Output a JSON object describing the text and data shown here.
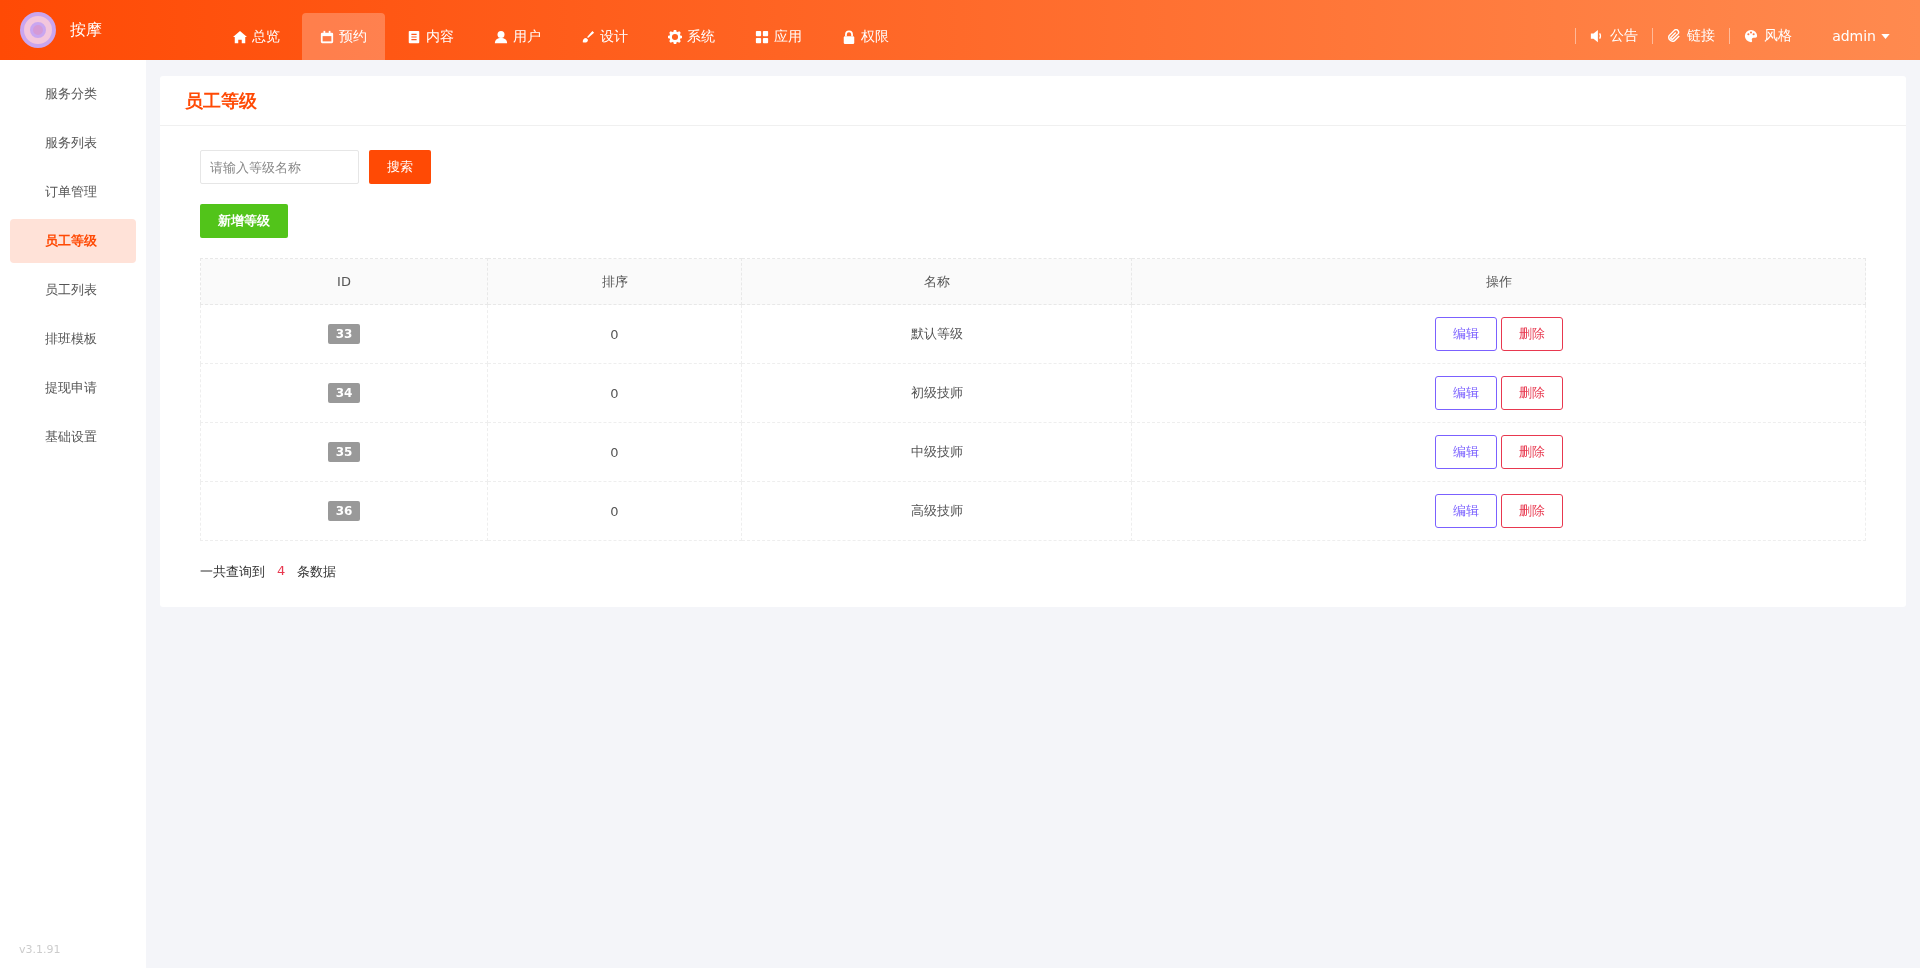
{
  "brand": {
    "name": "按摩"
  },
  "nav": [
    {
      "label": "总览",
      "kind": "home",
      "selected": false
    },
    {
      "label": "预约",
      "kind": "calendar",
      "selected": true
    },
    {
      "label": "内容",
      "kind": "document",
      "selected": false
    },
    {
      "label": "用户",
      "kind": "user",
      "selected": false
    },
    {
      "label": "设计",
      "kind": "brush",
      "selected": false
    },
    {
      "label": "系统",
      "kind": "gear",
      "selected": false
    },
    {
      "label": "应用",
      "kind": "grid",
      "selected": false
    },
    {
      "label": "权限",
      "kind": "lock",
      "selected": false
    }
  ],
  "header_links": [
    {
      "label": "公告",
      "kind": "speaker"
    },
    {
      "label": "链接",
      "kind": "paperclip"
    },
    {
      "label": "风格",
      "kind": "palette"
    }
  ],
  "user_menu": {
    "label": "admin"
  },
  "sidebar": {
    "items": [
      {
        "label": "服务分类",
        "selected": false
      },
      {
        "label": "服务列表",
        "selected": false
      },
      {
        "label": "订单管理",
        "selected": false
      },
      {
        "label": "员工等级",
        "selected": true
      },
      {
        "label": "员工列表",
        "selected": false
      },
      {
        "label": "排班模板",
        "selected": false
      },
      {
        "label": "提现申请",
        "selected": false
      },
      {
        "label": "基础设置",
        "selected": false
      }
    ],
    "version": "v3.1.91"
  },
  "page": {
    "title": "员工等级",
    "search": {
      "placeholder": "请输入等级名称",
      "button": "搜索"
    },
    "add_button": "新增等级",
    "table": {
      "columns": [
        "ID",
        "排序",
        "名称",
        "操作"
      ],
      "rows": [
        {
          "id": "33",
          "sort": "0",
          "name": "默认等级",
          "actions": [
            "编辑",
            "删除"
          ]
        },
        {
          "id": "34",
          "sort": "0",
          "name": "初级技师",
          "actions": [
            "编辑",
            "删除"
          ]
        },
        {
          "id": "35",
          "sort": "0",
          "name": "中级技师",
          "actions": [
            "编辑",
            "删除"
          ]
        },
        {
          "id": "36",
          "sort": "0",
          "name": "高级技师",
          "actions": [
            "编辑",
            "删除"
          ]
        }
      ]
    },
    "summary": {
      "prefix": "一共查询到",
      "count": "4",
      "suffix": "条数据"
    }
  }
}
